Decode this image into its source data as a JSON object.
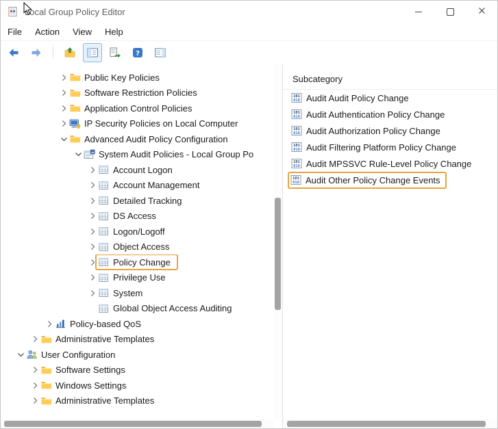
{
  "window": {
    "title": "Local Group Policy Editor"
  },
  "menu": {
    "items": [
      "File",
      "Action",
      "View",
      "Help"
    ]
  },
  "toolbar": {
    "buttons": [
      {
        "id": "back",
        "icon": "back"
      },
      {
        "id": "forward",
        "icon": "forward"
      },
      {
        "id": "sep"
      },
      {
        "id": "up-one-level",
        "icon": "upfolder"
      },
      {
        "id": "show-console-tree",
        "icon": "consoletree",
        "active": true
      },
      {
        "id": "export-list",
        "icon": "exportlist"
      },
      {
        "id": "help",
        "icon": "help"
      },
      {
        "id": "show-action-pane",
        "icon": "actionpane"
      }
    ]
  },
  "tree": {
    "items": [
      {
        "label": "Public Key Policies",
        "level": 4,
        "state": "collapsed",
        "icon": "folder"
      },
      {
        "label": "Software Restriction Policies",
        "level": 4,
        "state": "collapsed",
        "icon": "folder"
      },
      {
        "label": "Application Control Policies",
        "level": 4,
        "state": "collapsed",
        "icon": "folder"
      },
      {
        "label": "IP Security Policies on Local Computer",
        "level": 4,
        "state": "collapsed",
        "icon": "ipsec"
      },
      {
        "label": "Advanced Audit Policy Configuration",
        "level": 4,
        "state": "expanded",
        "icon": "folder"
      },
      {
        "label": "System Audit Policies - Local Group Po",
        "level": 5,
        "state": "expanded",
        "icon": "auditroot"
      },
      {
        "label": "Account Logon",
        "level": 6,
        "state": "collapsed",
        "icon": "audit"
      },
      {
        "label": "Account Management",
        "level": 6,
        "state": "collapsed",
        "icon": "audit"
      },
      {
        "label": "Detailed Tracking",
        "level": 6,
        "state": "collapsed",
        "icon": "audit"
      },
      {
        "label": "DS Access",
        "level": 6,
        "state": "collapsed",
        "icon": "audit"
      },
      {
        "label": "Logon/Logoff",
        "level": 6,
        "state": "collapsed",
        "icon": "audit"
      },
      {
        "label": "Object Access",
        "level": 6,
        "state": "collapsed",
        "icon": "audit"
      },
      {
        "label": "Policy Change",
        "level": 6,
        "state": "collapsed",
        "icon": "audit",
        "highlighted": true
      },
      {
        "label": "Privilege Use",
        "level": 6,
        "state": "collapsed",
        "icon": "audit"
      },
      {
        "label": "System",
        "level": 6,
        "state": "collapsed",
        "icon": "audit"
      },
      {
        "label": "Global Object Access Auditing",
        "level": 6,
        "state": "none",
        "icon": "audit"
      },
      {
        "label": "Policy-based QoS",
        "level": 3,
        "state": "collapsed",
        "icon": "qos"
      },
      {
        "label": "Administrative Templates",
        "level": 2,
        "state": "collapsed",
        "icon": "folder"
      },
      {
        "label": "User Configuration",
        "level": 1,
        "state": "expanded",
        "icon": "userconfig"
      },
      {
        "label": "Software Settings",
        "level": 2,
        "state": "collapsed",
        "icon": "folder"
      },
      {
        "label": "Windows Settings",
        "level": 2,
        "state": "collapsed",
        "icon": "folder"
      },
      {
        "label": "Administrative Templates",
        "level": 2,
        "state": "collapsed",
        "icon": "folder"
      }
    ]
  },
  "list": {
    "header": "Subcategory",
    "items": [
      {
        "label": "Audit Audit Policy Change",
        "icon": "binary"
      },
      {
        "label": "Audit Authentication Policy Change",
        "icon": "binary"
      },
      {
        "label": "Audit Authorization Policy Change",
        "icon": "binary"
      },
      {
        "label": "Audit Filtering Platform Policy Change",
        "icon": "binary"
      },
      {
        "label": "Audit MPSSVC Rule-Level Policy Change",
        "icon": "binary"
      },
      {
        "label": "Audit Other Policy Change Events",
        "icon": "binary",
        "highlighted": true
      }
    ]
  },
  "colors": {
    "highlight": "#E8A33D"
  }
}
